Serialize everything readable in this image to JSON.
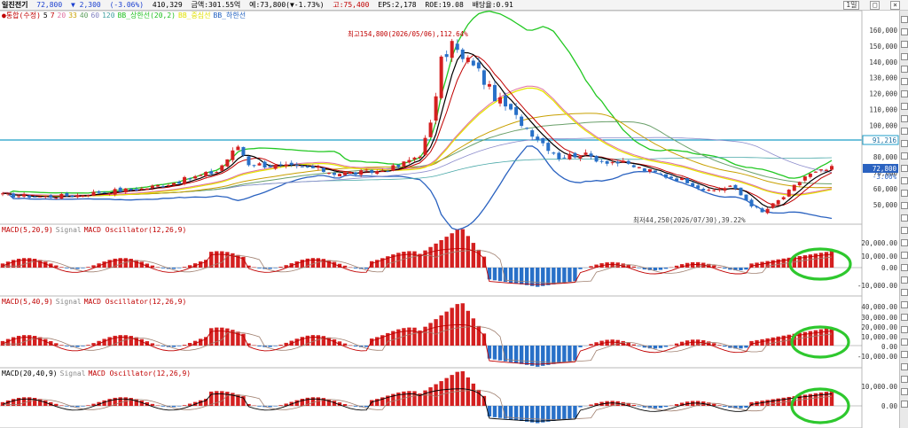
{
  "header": {
    "stock_name": "일진전기",
    "price": "72,800",
    "change": "▼ 2,300",
    "change_pct": "(-3.06%)",
    "volume": "410,329",
    "amount": "금액:301.55억",
    "open_low": "예:73,800(▼-1.73%)",
    "high": "고:75,400",
    "eps": "EPS:2,178",
    "roe": "ROE:19.08",
    "dividend": "배당율:0.91"
  },
  "window_controls": [
    "1일",
    "□",
    "×"
  ],
  "price_legend": [
    {
      "label": "●통합(수정)",
      "color": "#c00000"
    },
    {
      "label": "5",
      "color": "#000000"
    },
    {
      "label": "7",
      "color": "#c00000"
    },
    {
      "label": "20",
      "color": "#e070a0"
    },
    {
      "label": "33",
      "color": "#c8a000"
    },
    {
      "label": "40",
      "color": "#60a060"
    },
    {
      "label": "60",
      "color": "#8080c0"
    },
    {
      "label": "120",
      "color": "#40a0a0"
    },
    {
      "label": "BB_상한선(20,2)",
      "color": "#20c020"
    },
    {
      "label": "BB_중심선",
      "color": "#e0e000"
    },
    {
      "label": "BB_하한선",
      "color": "#2060c0"
    }
  ],
  "annotations": {
    "max_label": "최고154,800(2026/05/06),112.64%",
    "min_label": "최저44,250(2026/07/30),39.22%"
  },
  "price_axis": [
    "160,000",
    "150,000",
    "140,000",
    "130,000",
    "120,000",
    "110,000",
    "100,000",
    "90,000",
    "80,000",
    "70,000",
    "60,000",
    "50,000"
  ],
  "price_markers": {
    "ref_line": "91,216",
    "current": "72,800",
    "current_pct": "-3.06%"
  },
  "macd_panels": [
    {
      "title": "MACD(5,20,9)",
      "signal": "Signal",
      "osc": "MACD Oscillator(12,26,9)",
      "axis": [
        "20,000.00",
        "10,000.00",
        "0.00",
        "-10,000.00"
      ]
    },
    {
      "title": "MACD(5,40,9)",
      "signal": "Signal",
      "osc": "MACD Oscillator(12,26,9)",
      "axis": [
        "40,000.00",
        "30,000.00",
        "20,000.00",
        "10,000.00",
        "0.00",
        "-10,000.00"
      ]
    },
    {
      "title": "MACD(20,40,9)",
      "signal": "Signal",
      "osc": "MACD Oscillator(12,26,9)",
      "axis": [
        "10,000.00",
        "0.00"
      ]
    }
  ],
  "colors": {
    "up": "#d42020",
    "down": "#2870c8",
    "ref_line": "#1c9ec8",
    "highlight": "#2ec82e"
  }
}
